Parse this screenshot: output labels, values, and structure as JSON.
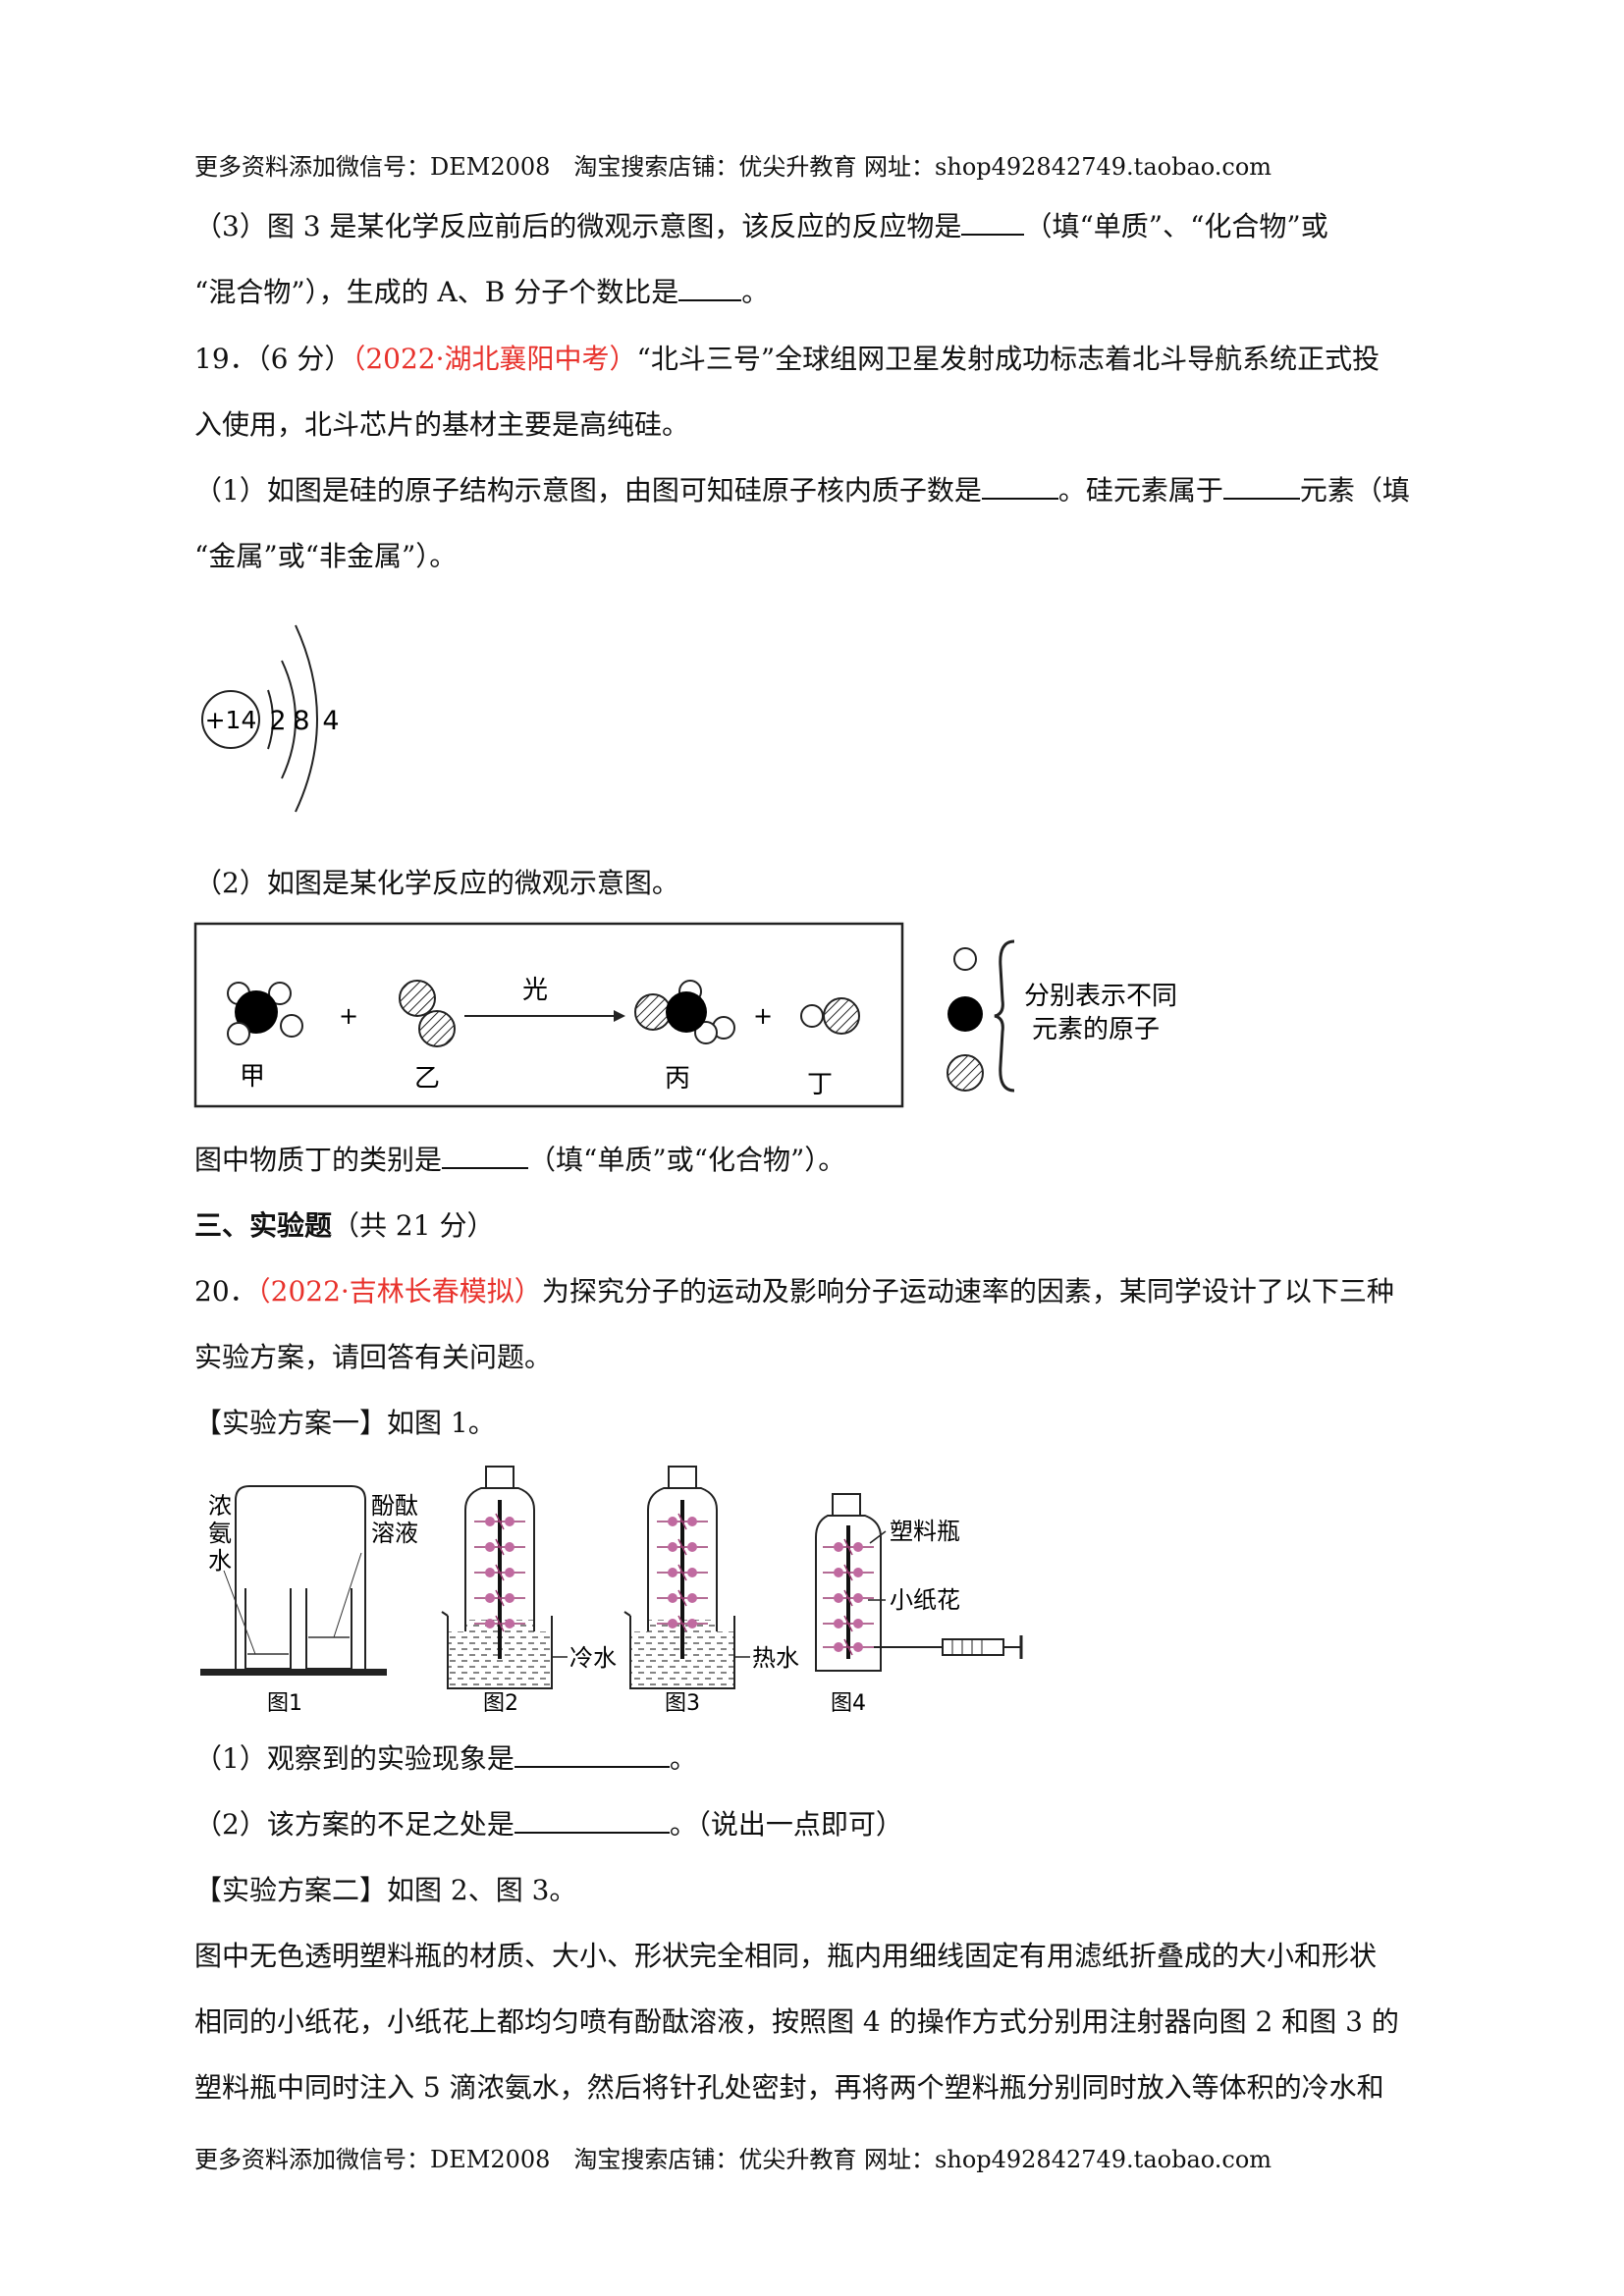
{
  "header": {
    "text": "更多资料添加微信号：DEM2008　淘宝搜索店铺：优尖升教育  网址：shop492842749.taobao.com"
  },
  "footer": {
    "text": "更多资料添加微信号：DEM2008　淘宝搜索店铺：优尖升教育  网址：shop492842749.taobao.com"
  },
  "q18_3": {
    "l1a": "（3）图 3 是某化学反应前后的微观示意图，该反应的反应物是",
    "l1b": "（填“单质”、“化合物”或",
    "l2a": "“混合物”），生成的 A、B 分子个数比是",
    "l2b": "。"
  },
  "q19": {
    "num": "19．（6 分）",
    "source": "（2022·湖北襄阳中考）",
    "l1": "“北斗三号”全球组网卫星发射成功标志着北斗导航系统正式投",
    "l2": "入使用，北斗芯片的基材主要是高纯硅。",
    "p1a": "（1）如图是硅的原子结构示意图，由图可知硅原子核内质子数是",
    "p1b": "。硅元素属于",
    "p1c": "元素（填",
    "p1d": "“金属”或“非金属”）。",
    "atom": {
      "nucleus": "+14",
      "shells": [
        "2",
        "8",
        "4"
      ]
    },
    "p2": "（2）如图是某化学反应的微观示意图。",
    "reaction": {
      "arrow_label": "光",
      "labels": [
        "甲",
        "乙",
        "丙",
        "丁"
      ],
      "legend_l1": "分别表示不同",
      "legend_l2": "元素的原子"
    },
    "p3a": "图中物质丁的类别是",
    "p3b": "（填“单质”或“化合物”）。"
  },
  "section3": {
    "title": "三、实验题",
    "note": "（共 21 分）"
  },
  "q20": {
    "num": "20．",
    "source": "（2022·吉林长春模拟）",
    "l1": "为探究分子的运动及影响分子运动速率的因素，某同学设计了以下三种",
    "l2": "实验方案，请回答有关问题。",
    "plan1": "【实验方案一】如图 1。",
    "figure": {
      "fig1_left": [
        "浓",
        "氨",
        "水"
      ],
      "fig1_right": [
        "酚酞",
        "溶液"
      ],
      "cold": "冷水",
      "hot": "热水",
      "bottle": "塑料瓶",
      "flower": "小纸花",
      "captions": [
        "图1",
        "图2",
        "图3",
        "图4"
      ]
    },
    "q1a": "（1）观察到的实验现象是",
    "q1b": "。",
    "q2a": "（2）该方案的不足之处是",
    "q2b": "。（说出一点即可）",
    "plan2": "【实验方案二】如图 2、图 3。",
    "d1": "图中无色透明塑料瓶的材质、大小、形状完全相同，瓶内用细线固定有用滤纸折叠成的大小和形状",
    "d2": "相同的小纸花，小纸花上都均匀喷有酚酞溶液，按照图 4 的操作方式分别用注射器向图 2 和图 3 的",
    "d3": "塑料瓶中同时注入 5 滴浓氨水，然后将针孔处密封，再将两个塑料瓶分别同时放入等体积的冷水和"
  }
}
